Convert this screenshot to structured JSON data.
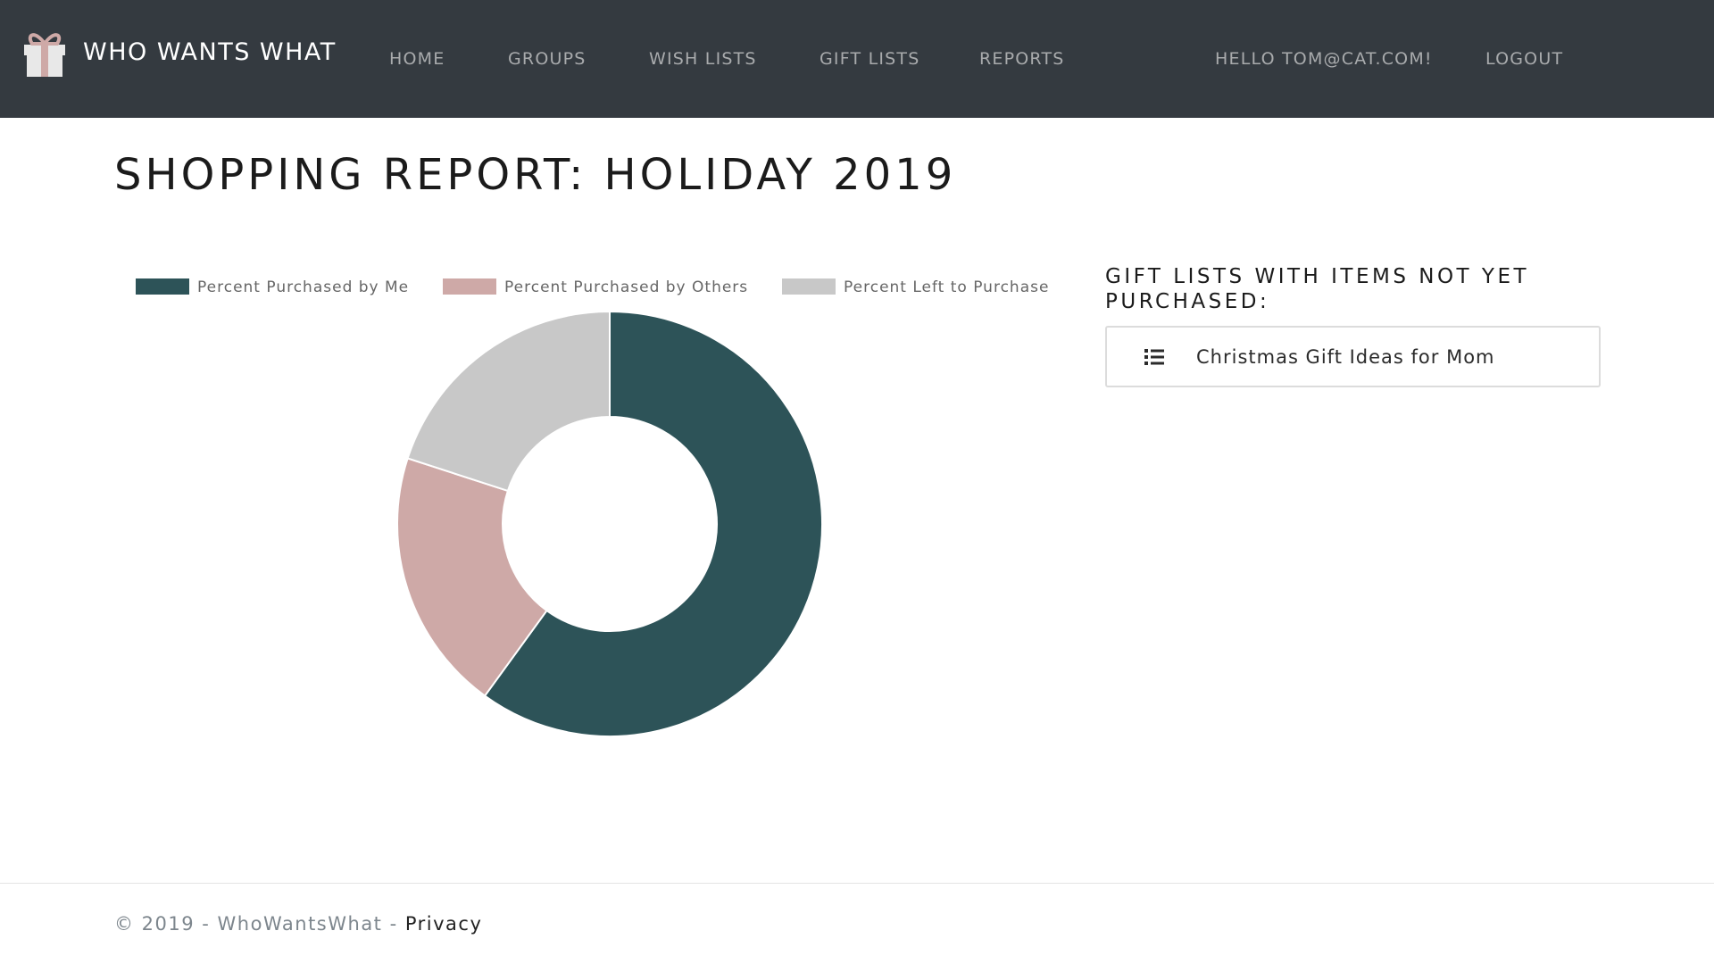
{
  "brand": {
    "name": "WHO WANTS WHAT",
    "icon": "gift-box-icon"
  },
  "nav": {
    "home": "HOME",
    "groups": "GROUPS",
    "wish_lists": "WISH LISTS",
    "gift_lists": "GIFT LISTS",
    "reports": "REPORTS",
    "greeting": "HELLO TOM@CAT.COM!",
    "logout": "LOGOUT"
  },
  "page": {
    "title": "SHOPPING REPORT: HOLIDAY 2019"
  },
  "sidebar": {
    "heading": "GIFT LISTS WITH ITEMS NOT YET PURCHASED:",
    "items": [
      {
        "label": "Christmas Gift Ideas for Mom",
        "icon": "list-icon"
      }
    ]
  },
  "chart_data": {
    "type": "pie",
    "subtype": "doughnut",
    "legend_position": "top",
    "series": [
      {
        "name": "Percent Purchased by Me",
        "value": 60,
        "color": "#2d5358"
      },
      {
        "name": "Percent Purchased by Others",
        "value": 20,
        "color": "#cea9a7"
      },
      {
        "name": "Percent Left to Purchase",
        "value": 20,
        "color": "#c8c8c8"
      }
    ]
  },
  "footer": {
    "copyright": "© 2019 - WhoWantsWhat - ",
    "privacy": "Privacy"
  },
  "colors": {
    "navbar_bg": "#343a40",
    "nav_link": "#a9abad",
    "brand_text": "#ffffff",
    "accent_pink": "#cea9a7"
  }
}
